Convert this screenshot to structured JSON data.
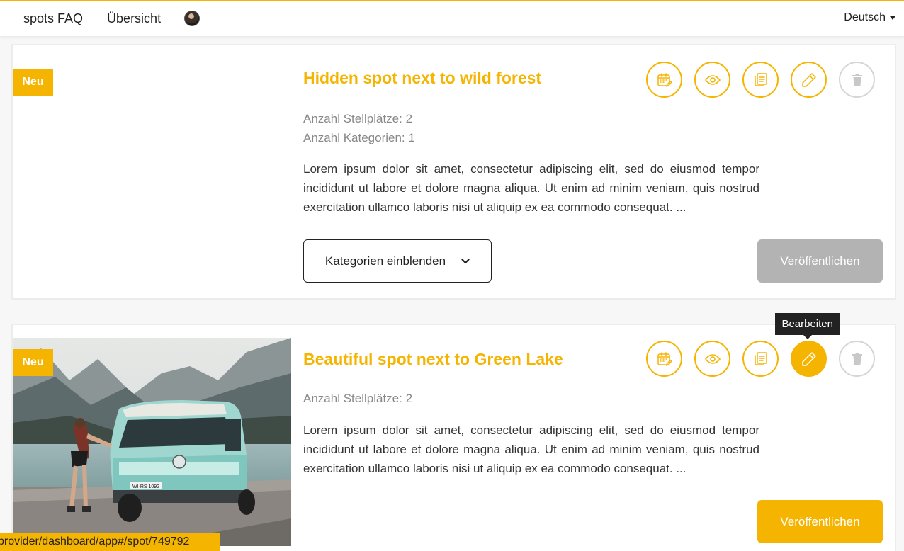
{
  "nav": {
    "faq": "spots FAQ",
    "overview": "Übersicht",
    "language": "Deutsch"
  },
  "spots": [
    {
      "badge": "Neu",
      "title": "Hidden spot next to wild forest",
      "meta": [
        "Anzahl Stellplätze: 2",
        "Anzahl Kategorien: 1"
      ],
      "description": "Lorem ipsum dolor sit amet, consectetur adipiscing elit, sed do eiusmod tempor incididunt ut labore et dolore magna aliqua. Ut enim ad minim veniam, quis nostrud exercitation ullamco laboris nisi ut aliquip ex ea commodo consequat. ...",
      "categories_button": "Kategorien einblenden",
      "publish_button": "Veröffentlichen"
    },
    {
      "badge": "Neu",
      "title": "Beautiful spot next to Green Lake",
      "meta": [
        "Anzahl Stellplätze: 2"
      ],
      "description": "Lorem ipsum dolor sit amet, consectetur adipiscing elit, sed do eiusmod tempor incididunt ut labore et dolore magna aliqua. Ut enim ad minim veniam, quis nostrud exercitation ullamco laboris nisi ut aliquip ex ea commodo consequat. ...",
      "tooltip": "Bearbeiten",
      "publish_button": "Veröffentlichen",
      "photo_plate": "WI·RS 1092"
    }
  ],
  "icons": [
    "calendar-icon",
    "eye-icon",
    "copy-icon",
    "pencil-icon",
    "trash-icon"
  ],
  "status_url": "provider/dashboard/app#/spot/749792",
  "colors": {
    "accent": "#f5b400",
    "disabled": "#b3b3b3"
  }
}
